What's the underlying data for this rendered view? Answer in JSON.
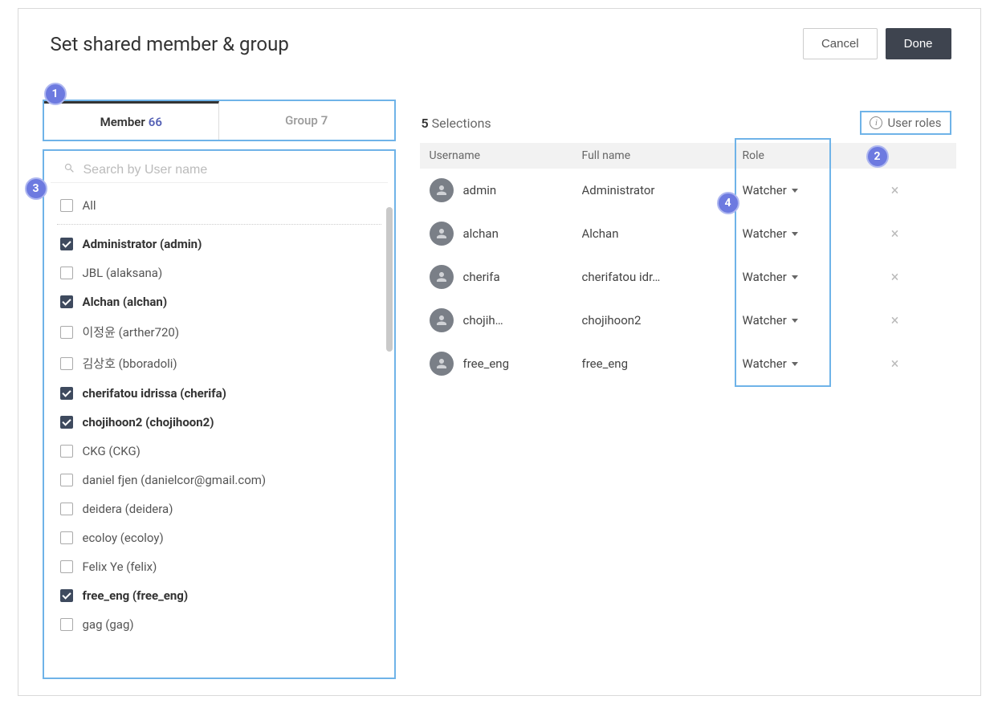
{
  "header": {
    "title": "Set shared member & group",
    "cancel_label": "Cancel",
    "done_label": "Done"
  },
  "tabs": {
    "member_label": "Member",
    "member_count": "66",
    "group_label": "Group",
    "group_count": "7"
  },
  "search": {
    "placeholder": "Search by User name"
  },
  "all_label": "All",
  "members": [
    {
      "label": "Administrator (admin)",
      "checked": true
    },
    {
      "label": "JBL (alaksana)",
      "checked": false
    },
    {
      "label": "Alchan (alchan)",
      "checked": true
    },
    {
      "label": "이정윤 (arther720)",
      "checked": false
    },
    {
      "label": "김상호 (bboradoli)",
      "checked": false
    },
    {
      "label": "cherifatou idrissa (cherifa)",
      "checked": true
    },
    {
      "label": "chojihoon2 (chojihoon2)",
      "checked": true
    },
    {
      "label": "CKG (CKG)",
      "checked": false
    },
    {
      "label": "daniel fjen (danielcor@gmail.com)",
      "checked": false
    },
    {
      "label": "deidera (deidera)",
      "checked": false
    },
    {
      "label": "ecoloy (ecoloy)",
      "checked": false
    },
    {
      "label": "Felix Ye (felix)",
      "checked": false
    },
    {
      "label": "free_eng (free_eng)",
      "checked": true
    },
    {
      "label": "gag (gag)",
      "checked": false
    }
  ],
  "selections": {
    "count": "5",
    "label": "Selections",
    "user_roles_label": "User roles",
    "columns": {
      "username": "Username",
      "fullname": "Full name",
      "role": "Role"
    },
    "rows": [
      {
        "username": "admin",
        "fullname": "Administrator",
        "role": "Watcher"
      },
      {
        "username": "alchan",
        "fullname": "Alchan",
        "role": "Watcher"
      },
      {
        "username": "cherifa",
        "fullname": "cherifatou idr…",
        "role": "Watcher"
      },
      {
        "username": "chojih…",
        "fullname": "chojihoon2",
        "role": "Watcher"
      },
      {
        "username": "free_eng",
        "fullname": "free_eng",
        "role": "Watcher"
      }
    ]
  },
  "badges": {
    "b1": "1",
    "b2": "2",
    "b3": "3",
    "b4": "4"
  }
}
